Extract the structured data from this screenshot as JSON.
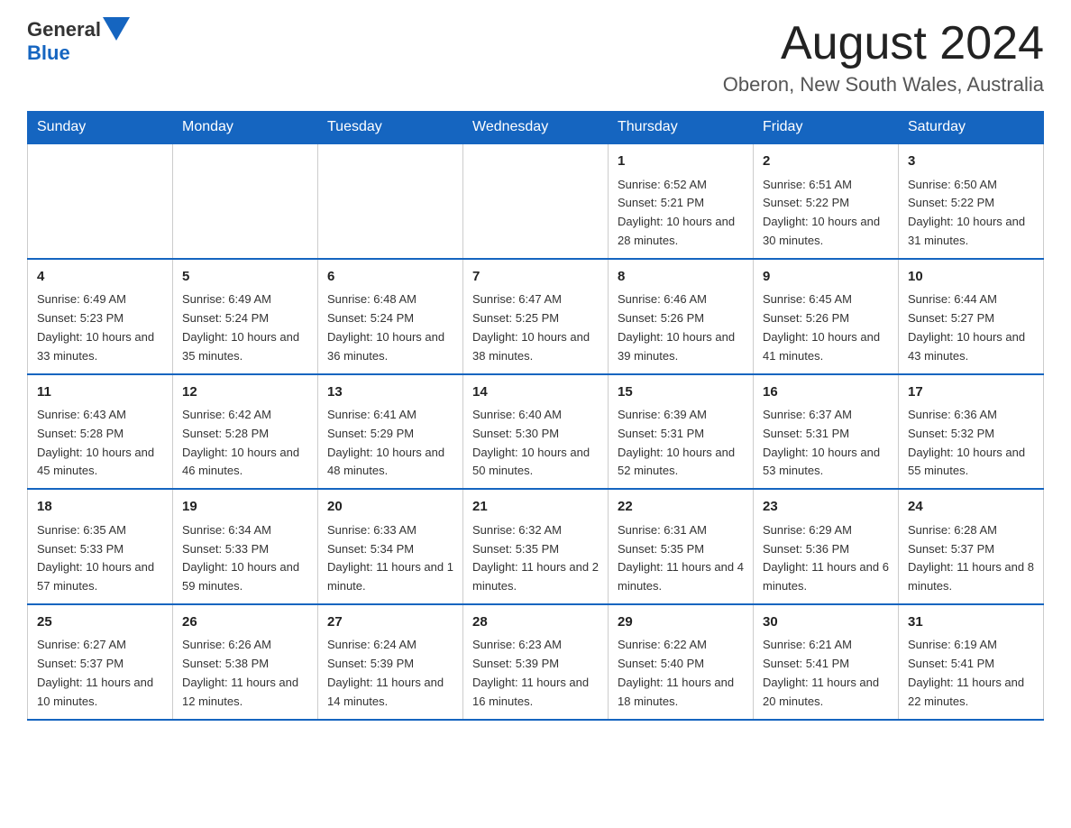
{
  "header": {
    "logo": {
      "general": "General",
      "blue": "Blue"
    },
    "title": "August 2024",
    "location": "Oberon, New South Wales, Australia"
  },
  "calendar": {
    "days_of_week": [
      "Sunday",
      "Monday",
      "Tuesday",
      "Wednesday",
      "Thursday",
      "Friday",
      "Saturday"
    ],
    "weeks": [
      [
        {
          "day": "",
          "sunrise": "",
          "sunset": "",
          "daylight": ""
        },
        {
          "day": "",
          "sunrise": "",
          "sunset": "",
          "daylight": ""
        },
        {
          "day": "",
          "sunrise": "",
          "sunset": "",
          "daylight": ""
        },
        {
          "day": "",
          "sunrise": "",
          "sunset": "",
          "daylight": ""
        },
        {
          "day": "1",
          "sunrise": "Sunrise: 6:52 AM",
          "sunset": "Sunset: 5:21 PM",
          "daylight": "Daylight: 10 hours and 28 minutes."
        },
        {
          "day": "2",
          "sunrise": "Sunrise: 6:51 AM",
          "sunset": "Sunset: 5:22 PM",
          "daylight": "Daylight: 10 hours and 30 minutes."
        },
        {
          "day": "3",
          "sunrise": "Sunrise: 6:50 AM",
          "sunset": "Sunset: 5:22 PM",
          "daylight": "Daylight: 10 hours and 31 minutes."
        }
      ],
      [
        {
          "day": "4",
          "sunrise": "Sunrise: 6:49 AM",
          "sunset": "Sunset: 5:23 PM",
          "daylight": "Daylight: 10 hours and 33 minutes."
        },
        {
          "day": "5",
          "sunrise": "Sunrise: 6:49 AM",
          "sunset": "Sunset: 5:24 PM",
          "daylight": "Daylight: 10 hours and 35 minutes."
        },
        {
          "day": "6",
          "sunrise": "Sunrise: 6:48 AM",
          "sunset": "Sunset: 5:24 PM",
          "daylight": "Daylight: 10 hours and 36 minutes."
        },
        {
          "day": "7",
          "sunrise": "Sunrise: 6:47 AM",
          "sunset": "Sunset: 5:25 PM",
          "daylight": "Daylight: 10 hours and 38 minutes."
        },
        {
          "day": "8",
          "sunrise": "Sunrise: 6:46 AM",
          "sunset": "Sunset: 5:26 PM",
          "daylight": "Daylight: 10 hours and 39 minutes."
        },
        {
          "day": "9",
          "sunrise": "Sunrise: 6:45 AM",
          "sunset": "Sunset: 5:26 PM",
          "daylight": "Daylight: 10 hours and 41 minutes."
        },
        {
          "day": "10",
          "sunrise": "Sunrise: 6:44 AM",
          "sunset": "Sunset: 5:27 PM",
          "daylight": "Daylight: 10 hours and 43 minutes."
        }
      ],
      [
        {
          "day": "11",
          "sunrise": "Sunrise: 6:43 AM",
          "sunset": "Sunset: 5:28 PM",
          "daylight": "Daylight: 10 hours and 45 minutes."
        },
        {
          "day": "12",
          "sunrise": "Sunrise: 6:42 AM",
          "sunset": "Sunset: 5:28 PM",
          "daylight": "Daylight: 10 hours and 46 minutes."
        },
        {
          "day": "13",
          "sunrise": "Sunrise: 6:41 AM",
          "sunset": "Sunset: 5:29 PM",
          "daylight": "Daylight: 10 hours and 48 minutes."
        },
        {
          "day": "14",
          "sunrise": "Sunrise: 6:40 AM",
          "sunset": "Sunset: 5:30 PM",
          "daylight": "Daylight: 10 hours and 50 minutes."
        },
        {
          "day": "15",
          "sunrise": "Sunrise: 6:39 AM",
          "sunset": "Sunset: 5:31 PM",
          "daylight": "Daylight: 10 hours and 52 minutes."
        },
        {
          "day": "16",
          "sunrise": "Sunrise: 6:37 AM",
          "sunset": "Sunset: 5:31 PM",
          "daylight": "Daylight: 10 hours and 53 minutes."
        },
        {
          "day": "17",
          "sunrise": "Sunrise: 6:36 AM",
          "sunset": "Sunset: 5:32 PM",
          "daylight": "Daylight: 10 hours and 55 minutes."
        }
      ],
      [
        {
          "day": "18",
          "sunrise": "Sunrise: 6:35 AM",
          "sunset": "Sunset: 5:33 PM",
          "daylight": "Daylight: 10 hours and 57 minutes."
        },
        {
          "day": "19",
          "sunrise": "Sunrise: 6:34 AM",
          "sunset": "Sunset: 5:33 PM",
          "daylight": "Daylight: 10 hours and 59 minutes."
        },
        {
          "day": "20",
          "sunrise": "Sunrise: 6:33 AM",
          "sunset": "Sunset: 5:34 PM",
          "daylight": "Daylight: 11 hours and 1 minute."
        },
        {
          "day": "21",
          "sunrise": "Sunrise: 6:32 AM",
          "sunset": "Sunset: 5:35 PM",
          "daylight": "Daylight: 11 hours and 2 minutes."
        },
        {
          "day": "22",
          "sunrise": "Sunrise: 6:31 AM",
          "sunset": "Sunset: 5:35 PM",
          "daylight": "Daylight: 11 hours and 4 minutes."
        },
        {
          "day": "23",
          "sunrise": "Sunrise: 6:29 AM",
          "sunset": "Sunset: 5:36 PM",
          "daylight": "Daylight: 11 hours and 6 minutes."
        },
        {
          "day": "24",
          "sunrise": "Sunrise: 6:28 AM",
          "sunset": "Sunset: 5:37 PM",
          "daylight": "Daylight: 11 hours and 8 minutes."
        }
      ],
      [
        {
          "day": "25",
          "sunrise": "Sunrise: 6:27 AM",
          "sunset": "Sunset: 5:37 PM",
          "daylight": "Daylight: 11 hours and 10 minutes."
        },
        {
          "day": "26",
          "sunrise": "Sunrise: 6:26 AM",
          "sunset": "Sunset: 5:38 PM",
          "daylight": "Daylight: 11 hours and 12 minutes."
        },
        {
          "day": "27",
          "sunrise": "Sunrise: 6:24 AM",
          "sunset": "Sunset: 5:39 PM",
          "daylight": "Daylight: 11 hours and 14 minutes."
        },
        {
          "day": "28",
          "sunrise": "Sunrise: 6:23 AM",
          "sunset": "Sunset: 5:39 PM",
          "daylight": "Daylight: 11 hours and 16 minutes."
        },
        {
          "day": "29",
          "sunrise": "Sunrise: 6:22 AM",
          "sunset": "Sunset: 5:40 PM",
          "daylight": "Daylight: 11 hours and 18 minutes."
        },
        {
          "day": "30",
          "sunrise": "Sunrise: 6:21 AM",
          "sunset": "Sunset: 5:41 PM",
          "daylight": "Daylight: 11 hours and 20 minutes."
        },
        {
          "day": "31",
          "sunrise": "Sunrise: 6:19 AM",
          "sunset": "Sunset: 5:41 PM",
          "daylight": "Daylight: 11 hours and 22 minutes."
        }
      ]
    ]
  }
}
